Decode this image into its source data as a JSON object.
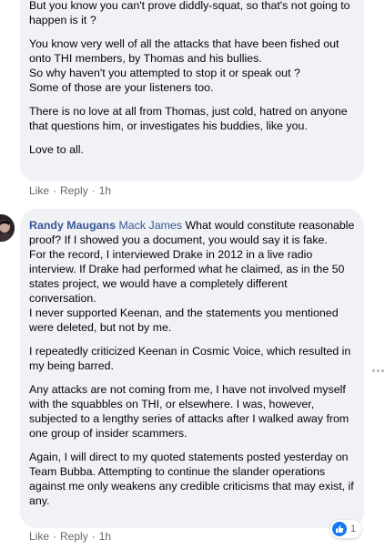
{
  "comment1": {
    "paragraphs": [
      "But you know you can't prove diddly-squat, so that's not going to happen is it ?",
      "You know very well of all the attacks that have been fished out onto THI members, by Thomas and his bullies.\nSo why haven't you attempted to stop it or speak out ?\nSome of those are your listeners too.",
      "There is no love at all from Thomas, just cold, hatred on anyone that questions him, or investigates his buddies, like you.",
      "Love to all."
    ],
    "actions": {
      "like": "Like",
      "reply": "Reply",
      "time": "1h"
    }
  },
  "comment2": {
    "author": "Randy Maugans",
    "mention": "Mack James",
    "intro": " What would constitute reasonable proof? If I showed you a document, you would say it is fake.",
    "paragraphs": [
      "For the record, I interviewed Drake in 2012 in a live radio interview. If Drake had performed what he claimed, as in the 50 states project, we would have a completely different conversation.\nI never supported Keenan, and the statements you mentioned were deleted, but not by me.",
      "I repeatedly criticized Keenan in Cosmic Voice, which resulted in my being barred.",
      "Any attacks are not coming from me, I have not involved myself with the squabbles on THI, or elsewhere. I was, however, subjected to a lengthy series of attacks after I walked away from one group of insider scammers.",
      "Again, I will direct to my quoted statements posted yesterday on Team Bubba. Attempting to continue the slander operations against me only weakens any credible criticisms that may exist, if any."
    ],
    "actions": {
      "like": "Like",
      "reply": "Reply",
      "time": "1h"
    },
    "reactions": {
      "count": "1",
      "icon": "thumbs-up-icon"
    }
  },
  "colors": {
    "link": "#385898",
    "bubble": "#f0f2f5",
    "meta": "#65676b",
    "like": "#1877f2"
  }
}
